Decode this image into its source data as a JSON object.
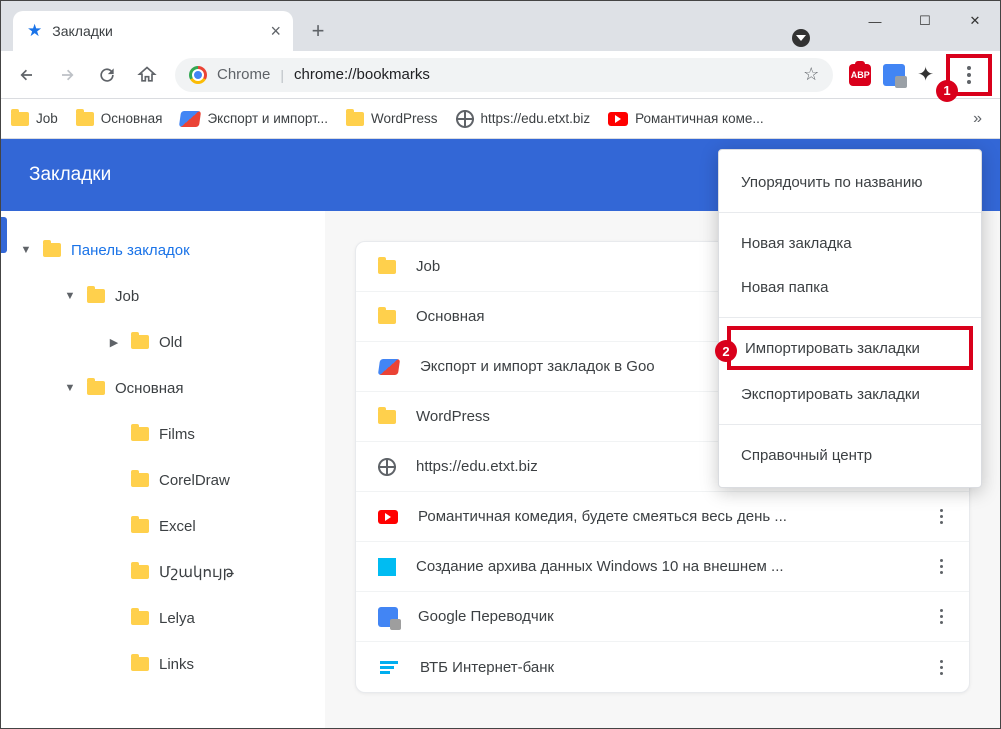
{
  "tab": {
    "title": "Закладки"
  },
  "omnibox": {
    "label": "Chrome",
    "url": "chrome://bookmarks"
  },
  "bookmarksBar": {
    "items": [
      {
        "label": "Job",
        "icon": "folder"
      },
      {
        "label": "Основная",
        "icon": "folder"
      },
      {
        "label": "Экспорт и импорт...",
        "icon": "export"
      },
      {
        "label": "WordPress",
        "icon": "folder"
      },
      {
        "label": "https://edu.etxt.biz",
        "icon": "globe"
      },
      {
        "label": "Романтичная коме...",
        "icon": "youtube"
      }
    ]
  },
  "header": {
    "title": "Закладки"
  },
  "tree": {
    "root": "Панель закладок",
    "job": "Job",
    "old": "Old",
    "osnovnaya": "Основная",
    "films": "Films",
    "corel": "CorelDraw",
    "excel": "Excel",
    "uzwunipe": "Մշակույթ",
    "lelya": "Lelya",
    "links": "Links"
  },
  "list": [
    {
      "label": "Job",
      "icon": "folder"
    },
    {
      "label": "Основная",
      "icon": "folder"
    },
    {
      "label": "Экспорт и импорт закладок в Goo",
      "icon": "export"
    },
    {
      "label": "WordPress",
      "icon": "folder"
    },
    {
      "label": "https://edu.etxt.biz",
      "icon": "globe"
    },
    {
      "label": "Романтичная комедия, будете смеяться весь день ...",
      "icon": "youtube"
    },
    {
      "label": "Создание архива данных Windows 10 на внешнем ...",
      "icon": "win"
    },
    {
      "label": "Google Переводчик",
      "icon": "gtrans"
    },
    {
      "label": "ВТБ Интернет-банк",
      "icon": "vtb"
    }
  ],
  "menu": {
    "sort": "Упорядочить по названию",
    "newBm": "Новая закладка",
    "newFolder": "Новая папка",
    "import": "Импортировать закладки",
    "export": "Экспортировать закладки",
    "help": "Справочный центр"
  },
  "callouts": {
    "one": "1",
    "two": "2"
  },
  "abp": "ABP"
}
